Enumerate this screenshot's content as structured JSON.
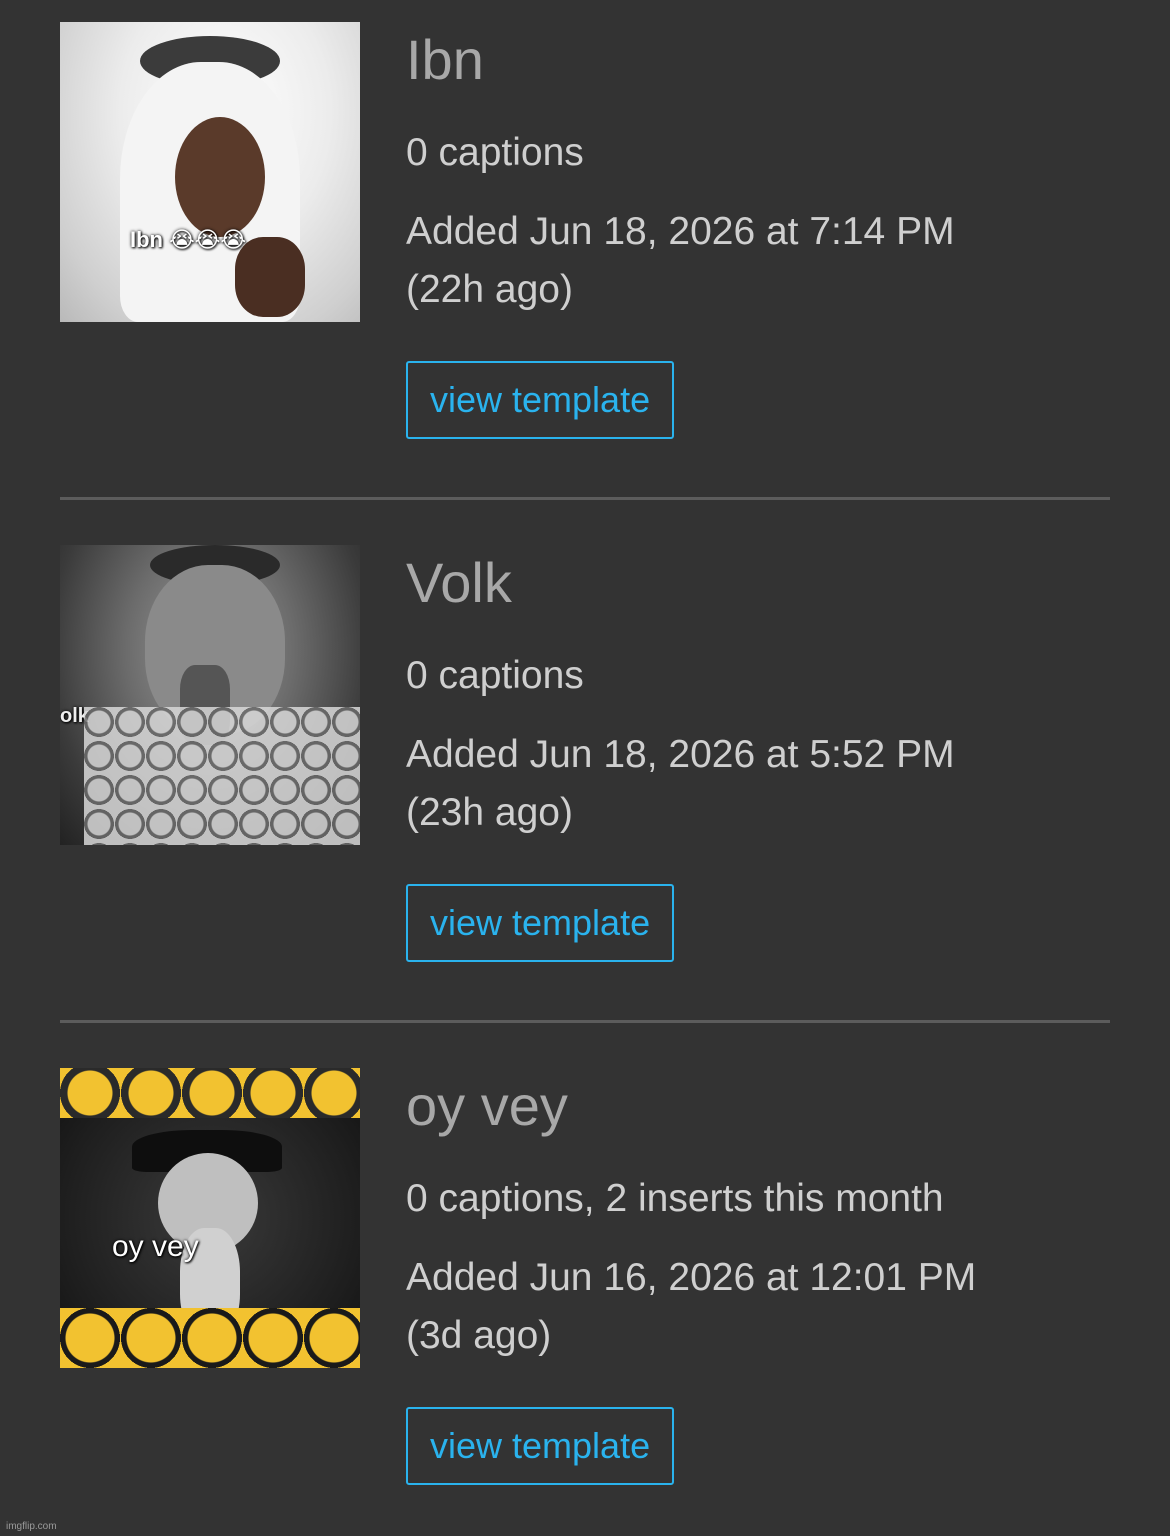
{
  "items": [
    {
      "title": "Ibn",
      "meta": "0 captions",
      "added": "Added Jun 18, 2026 at 7:14 PM",
      "ago": "(22h ago)",
      "button": "view template",
      "thumb_caption": "Ibn 😭😭😭"
    },
    {
      "title": "Volk",
      "meta": "0 captions",
      "added": "Added Jun 18, 2026 at 5:52 PM",
      "ago": "(23h ago)",
      "button": "view template",
      "thumb_caption": "olk"
    },
    {
      "title": "oy vey",
      "meta": "0 captions, 2 inserts this month",
      "added": "Added Jun 16, 2026 at 12:01 PM",
      "ago": "(3d ago)",
      "button": "view template",
      "thumb_caption": "oy vey"
    }
  ],
  "watermark": "imgflip.com",
  "colors": {
    "background": "#333333",
    "accent": "#2ab3ee",
    "divider": "#5c5c5c"
  }
}
